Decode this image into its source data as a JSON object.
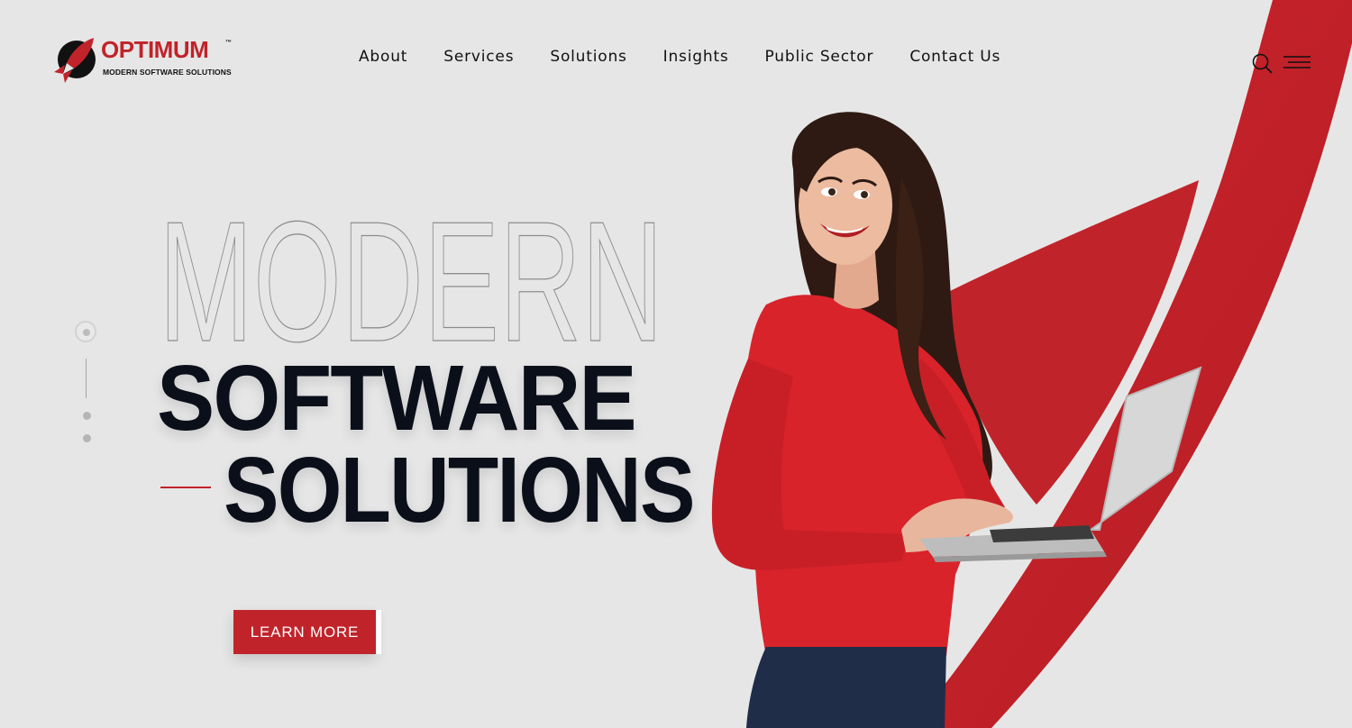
{
  "brand": {
    "name": "OPTIMUM",
    "trademark": "™",
    "tagline": "MODERN SOFTWARE SOLUTIONS",
    "accent_color": "#c1232a",
    "dark_color": "#0b0f1a"
  },
  "nav": {
    "items": [
      {
        "label": "About"
      },
      {
        "label": "Services"
      },
      {
        "label": "Solutions"
      },
      {
        "label": "Insights"
      },
      {
        "label": "Public Sector"
      },
      {
        "label": "Contact Us"
      }
    ]
  },
  "header_icons": {
    "search": "search-icon",
    "menu": "hamburger-menu-icon"
  },
  "hero": {
    "line1": "MODERN",
    "line2": "SOFTWARE",
    "line3": "SOLUTIONS",
    "cta_label": "LEARN MORE"
  },
  "slider": {
    "slide_count": 3,
    "active_index": 0
  }
}
